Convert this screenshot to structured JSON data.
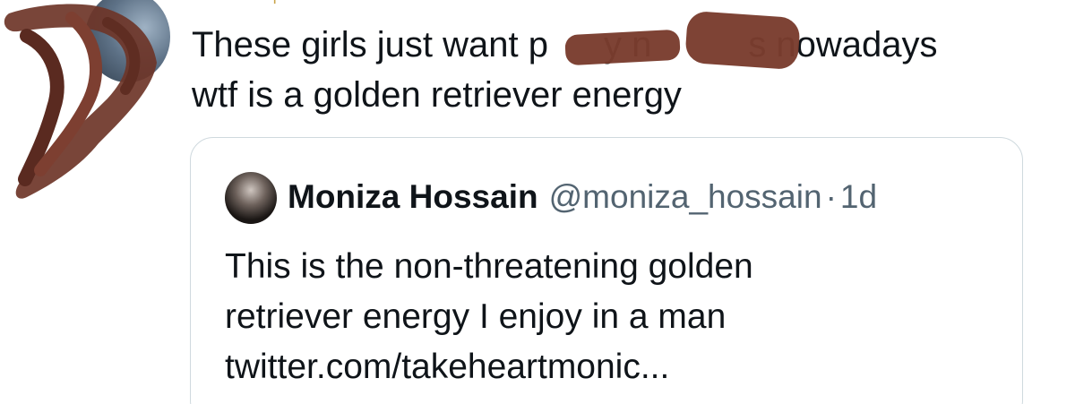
{
  "tweet": {
    "header_fragment": "⚲",
    "text_line1_a": "These girls just want p",
    "text_line1_b": "y n",
    "text_line1_c": "s nowadays",
    "text_line2": "wtf is a golden retriever energy"
  },
  "quoted_tweet": {
    "name": "Moniza Hossain",
    "handle": "@moniza_hossain",
    "separator": "·",
    "time": "1d",
    "text_line1": "This is the non-threatening golden",
    "text_line2": "retriever energy I enjoy in a man",
    "text_line3": "twitter.com/takeheartmonic..."
  },
  "colors": {
    "text": "#0f1419",
    "secondary": "#536471",
    "border": "#cfd9de",
    "redaction": "#7a3d2e"
  }
}
